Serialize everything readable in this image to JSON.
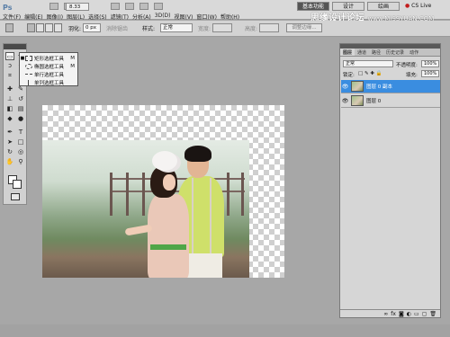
{
  "app": {
    "logo": "Ps",
    "zoom": "8.33",
    "menu": [
      "文件(F)",
      "编辑(E)",
      "图像(I)",
      "图层(L)",
      "选择(S)",
      "滤镜(T)",
      "分析(A)",
      "3D(D)",
      "视图(V)",
      "窗口(W)",
      "帮助(H)"
    ],
    "workspaces": [
      "基本功能",
      "设计",
      "绘画"
    ],
    "cslive": "CS Live",
    "watermark_cn": "思缘设计论坛",
    "watermark_url": "www.MISSYUAN.COM"
  },
  "options": {
    "feather_label": "羽化:",
    "feather_value": "0 px",
    "antialias_label": "消除锯齿",
    "style_label": "样式:",
    "style_value": "正常",
    "width_label": "宽度:",
    "height_label": "高度:",
    "refine_button": "调整边缘..."
  },
  "flyout": {
    "items": [
      {
        "label": "矩形选框工具",
        "key": "M"
      },
      {
        "label": "椭圆选框工具",
        "key": "M"
      },
      {
        "label": "单行选框工具",
        "key": ""
      },
      {
        "label": "单列选框工具",
        "key": ""
      }
    ]
  },
  "layers_panel": {
    "tabs": [
      "图层",
      "通道",
      "路径",
      "历史记录",
      "动作"
    ],
    "blend_mode": "正常",
    "opacity_label": "不透明度:",
    "opacity_value": "100%",
    "lock_label": "锁定:",
    "fill_label": "填充:",
    "fill_value": "100%",
    "layers": [
      {
        "name": "图层 0 副本",
        "active": true
      },
      {
        "name": "图层 0",
        "active": false
      }
    ]
  }
}
